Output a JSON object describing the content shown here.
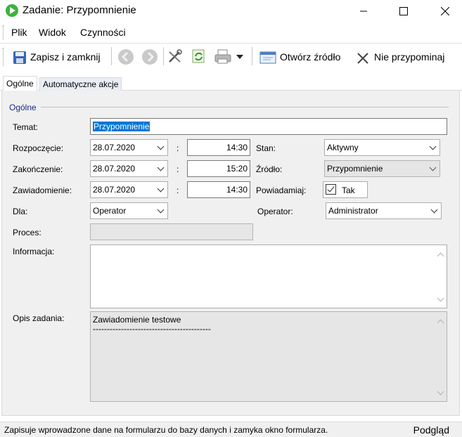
{
  "window": {
    "title": "Zadanie: Przypomnienie",
    "minimize_glyph": "—",
    "maximize_glyph": "☐",
    "close_glyph": "✕"
  },
  "menu": [
    "Plik",
    "Widok",
    "Czynności"
  ],
  "toolbar": {
    "save_close": "Zapisz i zamknij",
    "open_source": "Otwórz źródło",
    "dont_remind": "Nie przypominaj"
  },
  "tabs": [
    "Ogólne",
    "Automatyczne akcje"
  ],
  "form": {
    "group_title": "Ogólne",
    "subject_label": "Temat:",
    "subject_value": "Przypomnienie",
    "start_label": "Rozpoczęcie:",
    "start_date": "28.07.2020",
    "start_time": "14:30",
    "end_label": "Zakończenie:",
    "end_date": "28.07.2020",
    "end_time": "15:20",
    "notify_label": "Zawiadomienie:",
    "notify_date": "28.07.2020",
    "notify_time": "14:30",
    "colon": ":",
    "status_label": "Stan:",
    "status_value": "Aktywny",
    "source_label": "Źródło:",
    "source_value": "Przypomnienie",
    "remind_label": "Powiadamiaj:",
    "remind_value": "Tak",
    "for_label": "Dla:",
    "for_value": "Operator",
    "operator_label": "Operator:",
    "operator_value": "Administrator",
    "process_label": "Proces:",
    "process_value": "",
    "info_label": "Informacja:",
    "info_value": "",
    "desc_label": "Opis zadania:",
    "desc_line1": "Zawiadomienie testowe",
    "desc_line2": "------------------------------------------"
  },
  "status": {
    "text": "Zapisuje wprowadzone dane na formularzu do bazy danych i zamyka okno formularza.",
    "right": "Podgląd"
  }
}
